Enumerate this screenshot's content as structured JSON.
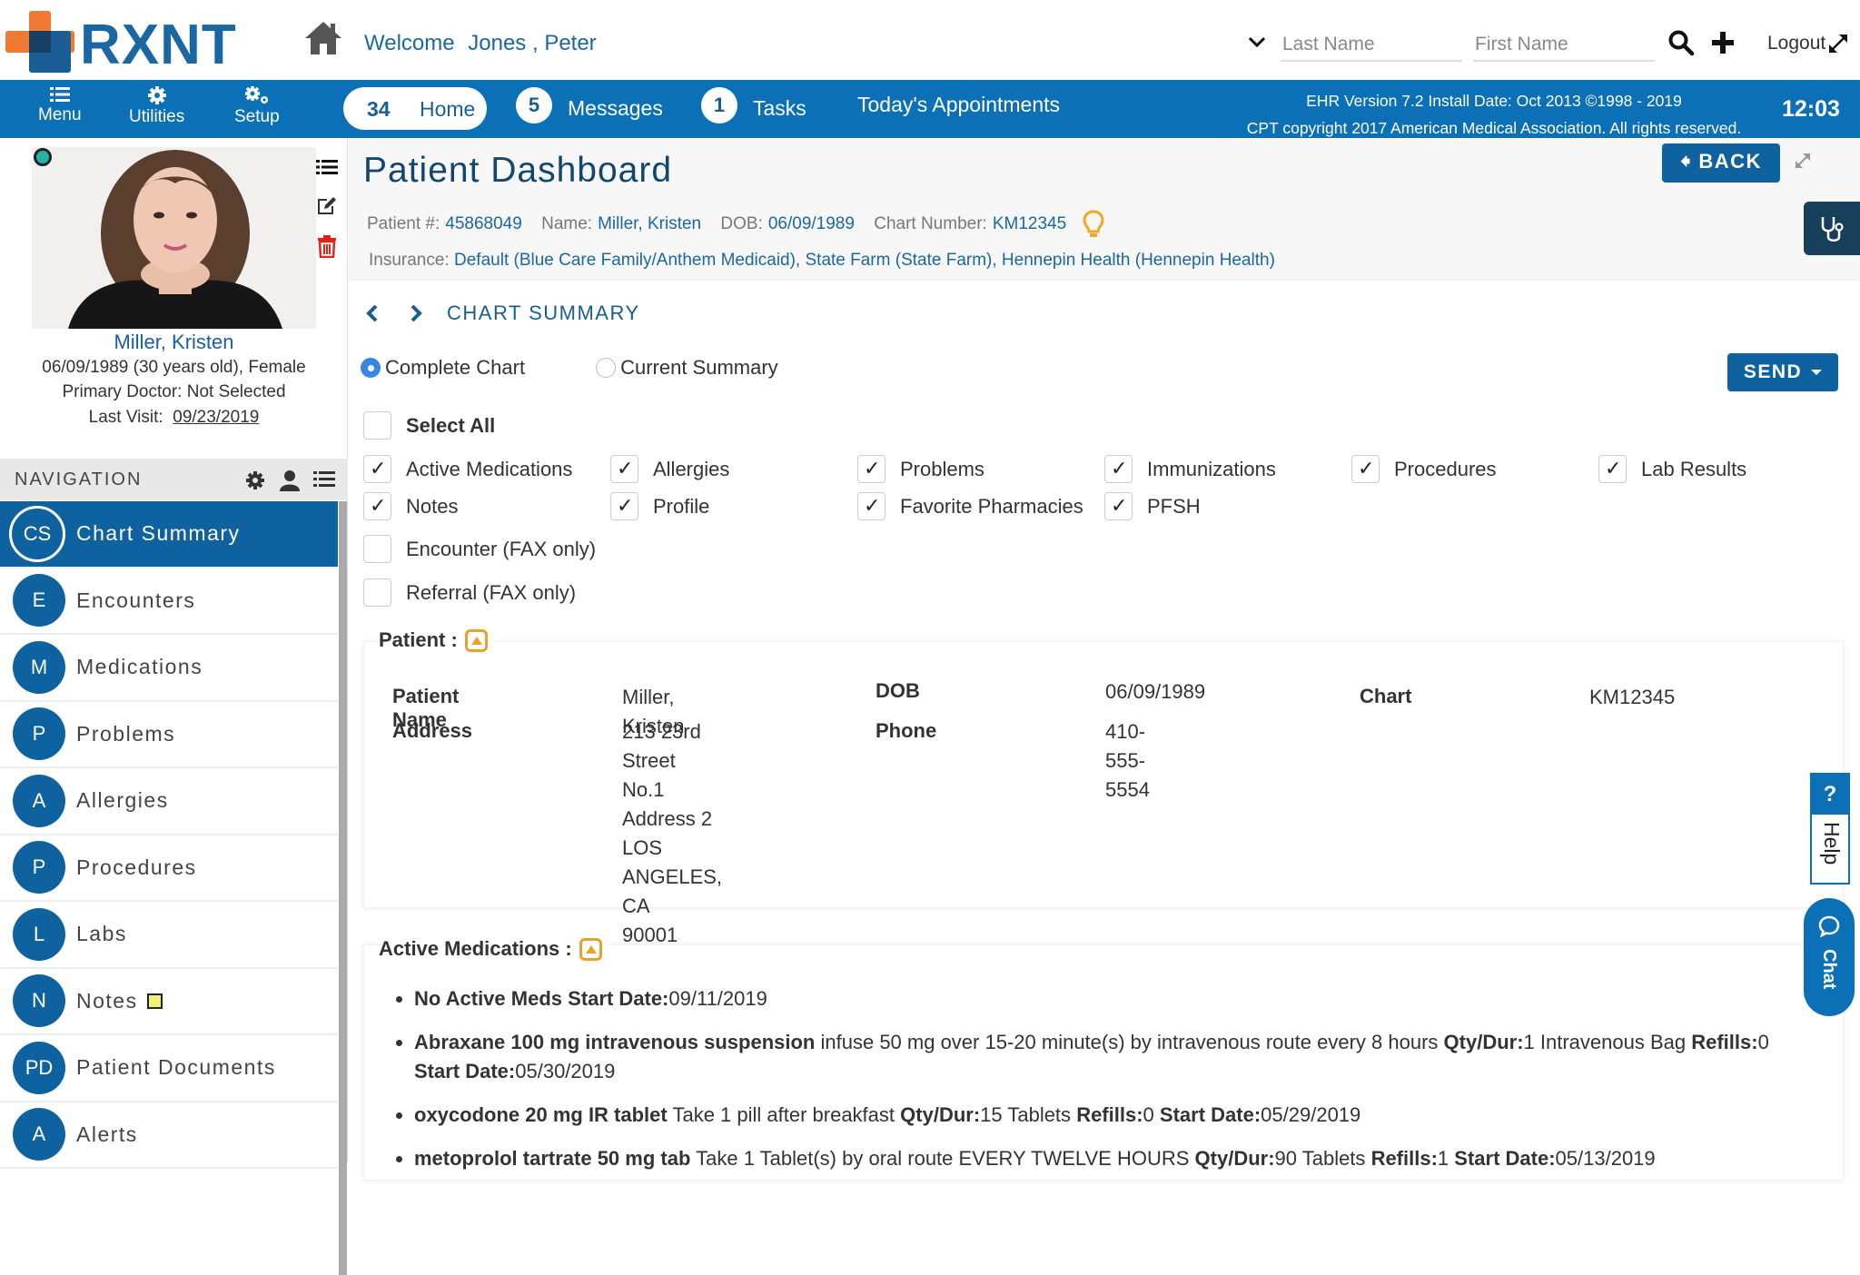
{
  "header": {
    "logo_text": "RXNT",
    "welcome_label": "Welcome",
    "user_name": "Jones , Peter",
    "search": {
      "last_name_placeholder": "Last Name",
      "first_name_placeholder": "First Name"
    },
    "logout_label": "Logout"
  },
  "navbar": {
    "tools": [
      {
        "label": "Menu",
        "icon": "list-icon"
      },
      {
        "label": "Utilities",
        "icon": "gear-icon"
      },
      {
        "label": "Setup",
        "icon": "gears-icon"
      }
    ],
    "home": {
      "count": "34",
      "label": "Home"
    },
    "messages": {
      "count": "5",
      "label": "Messages"
    },
    "tasks": {
      "count": "1",
      "label": "Tasks"
    },
    "appointments_label": "Today's Appointments",
    "version_line1": "EHR Version 7.2 Install Date: Oct 2013 ©1998 - 2019",
    "version_line2": "CPT copyright 2017 American Medical Association. All rights reserved.",
    "clock": "12:03"
  },
  "sidebar": {
    "patient_name": "Miller, Kristen",
    "dob_line": "06/09/1989 (30 years old), Female",
    "doctor_line": "Primary Doctor: Not Selected",
    "last_visit_label": "Last Visit:",
    "last_visit_date": "09/23/2019",
    "navigation_title": "NAVIGATION",
    "items": [
      {
        "abbr": "CS",
        "label": "Chart Summary",
        "active": true
      },
      {
        "abbr": "E",
        "label": "Encounters"
      },
      {
        "abbr": "M",
        "label": "Medications"
      },
      {
        "abbr": "P",
        "label": "Problems"
      },
      {
        "abbr": "A",
        "label": "Allergies"
      },
      {
        "abbr": "P",
        "label": "Procedures"
      },
      {
        "abbr": "L",
        "label": "Labs"
      },
      {
        "abbr": "N",
        "label": "Notes",
        "flag": true
      },
      {
        "abbr": "PD",
        "label": "Patient Documents"
      },
      {
        "abbr": "A",
        "label": "Alerts"
      }
    ]
  },
  "dashboard": {
    "title": "Patient Dashboard",
    "back_label": "BACK",
    "patient_no_label": "Patient #:",
    "patient_no": "45868049",
    "name_label": "Name:",
    "name": "Miller, Kristen",
    "dob_label": "DOB:",
    "dob": "06/09/1989",
    "chart_label": "Chart Number:",
    "chart_no": "KM12345",
    "insurance_label": "Insurance:",
    "insurance": "Default (Blue Care Family/Anthem Medicaid), State Farm (State Farm), Hennepin Health (Hennepin Health)"
  },
  "chart_summary": {
    "breadcrumb": "CHART SUMMARY",
    "radios": [
      {
        "label": "Complete Chart",
        "selected": true
      },
      {
        "label": "Current Summary",
        "selected": false
      }
    ],
    "send_label": "SEND",
    "select_all": {
      "label": "Select All",
      "checked": false
    },
    "options": [
      {
        "label": "Active Medications",
        "checked": true
      },
      {
        "label": "Allergies",
        "checked": true
      },
      {
        "label": "Problems",
        "checked": true
      },
      {
        "label": "Immunizations",
        "checked": true
      },
      {
        "label": "Procedures",
        "checked": true
      },
      {
        "label": "Lab Results",
        "checked": true
      },
      {
        "label": "Notes",
        "checked": true
      },
      {
        "label": "Profile",
        "checked": true
      },
      {
        "label": "Favorite Pharmacies",
        "checked": true
      },
      {
        "label": "PFSH",
        "checked": true
      }
    ],
    "fax_options": [
      {
        "label": "Encounter (FAX only)",
        "checked": false
      },
      {
        "label": "Referral (FAX only)",
        "checked": false
      }
    ]
  },
  "patient_section": {
    "title": "Patient :",
    "name_label": "Patient Name",
    "name": "Miller, Kristen",
    "address_label": "Address",
    "address_lines": [
      "213 23rd Street No.1",
      "Address 2",
      "LOS ANGELES,",
      "CA",
      "90001"
    ],
    "dob_label": "DOB",
    "dob": "06/09/1989",
    "phone_label": "Phone",
    "phone": "410-555-5554",
    "chart_label": "Chart",
    "chart": "KM12345"
  },
  "active_medications": {
    "title": "Active Medications :",
    "items": [
      {
        "name": "No Active Meds",
        "sig": "",
        "qty": "",
        "refills": "",
        "start": "09/11/2019"
      },
      {
        "name": "Abraxane 100 mg intravenous suspension",
        "sig": "infuse 50 mg over 15-20 minute(s) by intravenous route every 8 hours",
        "qty": "1 Intravenous Bag",
        "refills": "0",
        "start": "05/30/2019"
      },
      {
        "name": "oxycodone 20 mg IR tablet",
        "sig": "Take 1 pill after breakfast",
        "qty": "15 Tablets",
        "refills": "0",
        "start": "05/29/2019"
      },
      {
        "name": "metoprolol tartrate 50 mg tab",
        "sig": "Take 1 Tablet(s) by oral route EVERY TWELVE HOURS",
        "qty": "90 Tablets",
        "refills": "1",
        "start": "05/13/2019"
      }
    ],
    "labels": {
      "qty": "Qty/Dur:",
      "refills": "Refills:",
      "start": "Start Date:"
    }
  },
  "side_tabs": {
    "help_symbol": "?",
    "help_label": "Help",
    "chat_label": "Chat"
  }
}
